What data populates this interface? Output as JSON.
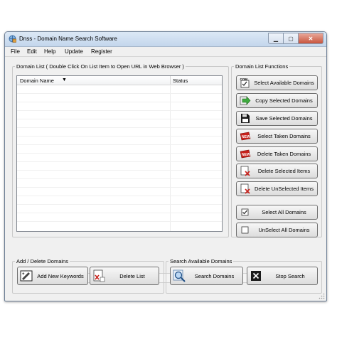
{
  "window": {
    "title": "Dnss - Domain Name Search Software",
    "controls": {
      "minimize": "▁",
      "maximize": "▢",
      "close": "✕"
    }
  },
  "menu": [
    "File",
    "Edit",
    "Help",
    "Update",
    "Register"
  ],
  "domain_list": {
    "legend": "Domain List ( Double Click On List Item to Open URL in Web Browser )",
    "columns": [
      "Domain Name",
      "Status"
    ],
    "sort_indicator": "▼",
    "rows": []
  },
  "functions": {
    "legend": "Domain List Functions",
    "buttons": [
      {
        "label": "Select Available Domains",
        "icon": "select-available-icon"
      },
      {
        "label": "Copy Selected Domains",
        "icon": "copy-arrow-icon"
      },
      {
        "label": "Save Selected Domains",
        "icon": "save-icon"
      },
      {
        "label": "Select Taken Domains",
        "icon": "select-taken-icon"
      },
      {
        "label": "Delete Taken Domains",
        "icon": "delete-taken-icon"
      },
      {
        "label": "Delete Selected Items",
        "icon": "delete-selected-icon"
      },
      {
        "label": "Delete UnSelected Items",
        "icon": "delete-unselected-icon"
      },
      {
        "label": "Select All Domains",
        "icon": "checkbox-checked-icon"
      },
      {
        "label": "UnSelect All Domains",
        "icon": "checkbox-empty-icon"
      }
    ]
  },
  "add_delete": {
    "legend": "Add / Delete Domains",
    "add_label": "Add New Keywords",
    "delete_label": "Delete List"
  },
  "search": {
    "legend": "Search Available Domains",
    "search_label": "Search Domains",
    "stop_label": "Stop Search"
  },
  "colors": {
    "accent_green": "#3faa3f",
    "accent_red": "#c8211b",
    "title_bar": "#c3d6ec"
  }
}
